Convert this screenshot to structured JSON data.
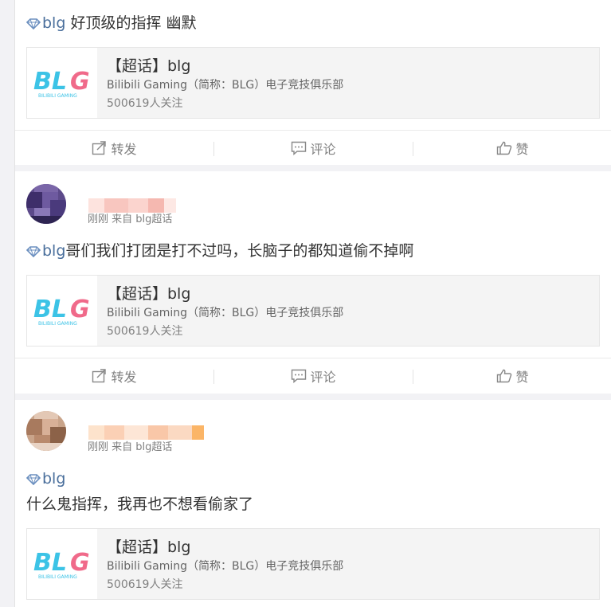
{
  "posts": [
    {
      "topic": "blg",
      "text": " 好顶级的指挥 幽默",
      "share": {
        "title": "【超话】blg",
        "desc": "Bilibili Gaming（简称：BLG）电子竞技俱乐部",
        "followers": "500619人关注"
      }
    },
    {
      "meta": "刚刚 来自 blg超话",
      "topic": "blg",
      "text": "哥们我们打团是打不过吗，长脑子的都知道偷不掉啊",
      "share": {
        "title": "【超话】blg",
        "desc": "Bilibili Gaming（简称：BLG）电子竞技俱乐部",
        "followers": "500619人关注"
      }
    },
    {
      "meta": "刚刚 来自 blg超话",
      "topic": "blg",
      "text_line2": "什么鬼指挥，我再也不想看偷家了",
      "share": {
        "title": "【超话】blg",
        "desc": "Bilibili Gaming（简称：BLG）电子竞技俱乐部",
        "followers": "500619人关注"
      }
    }
  ],
  "actions": {
    "repost": "转发",
    "comment": "评论",
    "like": "赞"
  },
  "logo_text": "BLG",
  "logo_sub": "BILIBILI GAMING",
  "colors": {
    "topic": "#4a6f9c",
    "logo_blue": "#3cc3e6",
    "logo_pink": "#f06a8a",
    "muted": "#808080"
  },
  "icons": [
    "diamond-icon",
    "repost-icon",
    "comment-icon",
    "like-icon"
  ]
}
